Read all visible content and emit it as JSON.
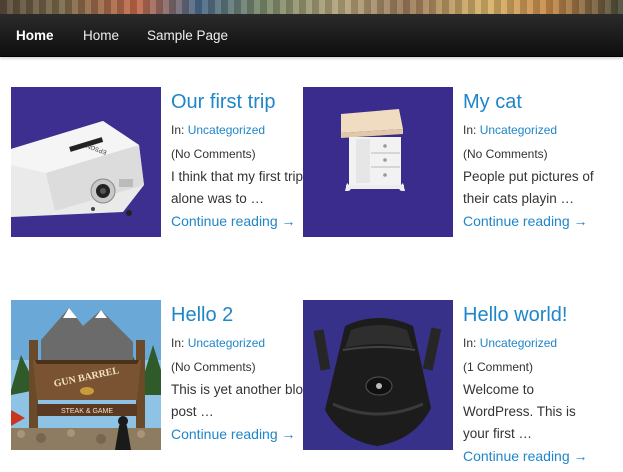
{
  "nav": {
    "brand": "Home",
    "items": [
      "Home",
      "Sample Page"
    ]
  },
  "posts": [
    {
      "title": "Our first trip",
      "category_prefix": "In: ",
      "category": "Uncategorized",
      "comments": "(No Comments)",
      "excerpt": "I think that my first trip alone was to …",
      "continue": "Continue reading →",
      "image": "projector"
    },
    {
      "title": "My cat",
      "category_prefix": "In: ",
      "category": "Uncategorized",
      "comments": "(No Comments)",
      "excerpt": "People put pictures of their cats playin …",
      "continue": "Continue reading →",
      "image": "nightstand"
    },
    {
      "title": "Hello 2",
      "category_prefix": "In: ",
      "category": "Uncategorized",
      "comments": "(No Comments)",
      "excerpt": "This is yet another blog post …",
      "continue": "Continue reading →",
      "image": "gun-barrel-sign"
    },
    {
      "title": "Hello world!",
      "category_prefix": "In: ",
      "category": "Uncategorized",
      "comments": "(1 Comment)",
      "excerpt": "Welcome to WordPress. This is your first …",
      "continue": "Continue reading →",
      "image": "camera-bag"
    }
  ],
  "colors": {
    "link": "#1e86c9",
    "nav_bg": "#111111",
    "photo_bg": "#3b2c8e"
  },
  "image_text": {
    "projector_brand": "EPSON",
    "sign_line1": "GUN BARREL",
    "sign_line2": "STEAK & GAME"
  }
}
